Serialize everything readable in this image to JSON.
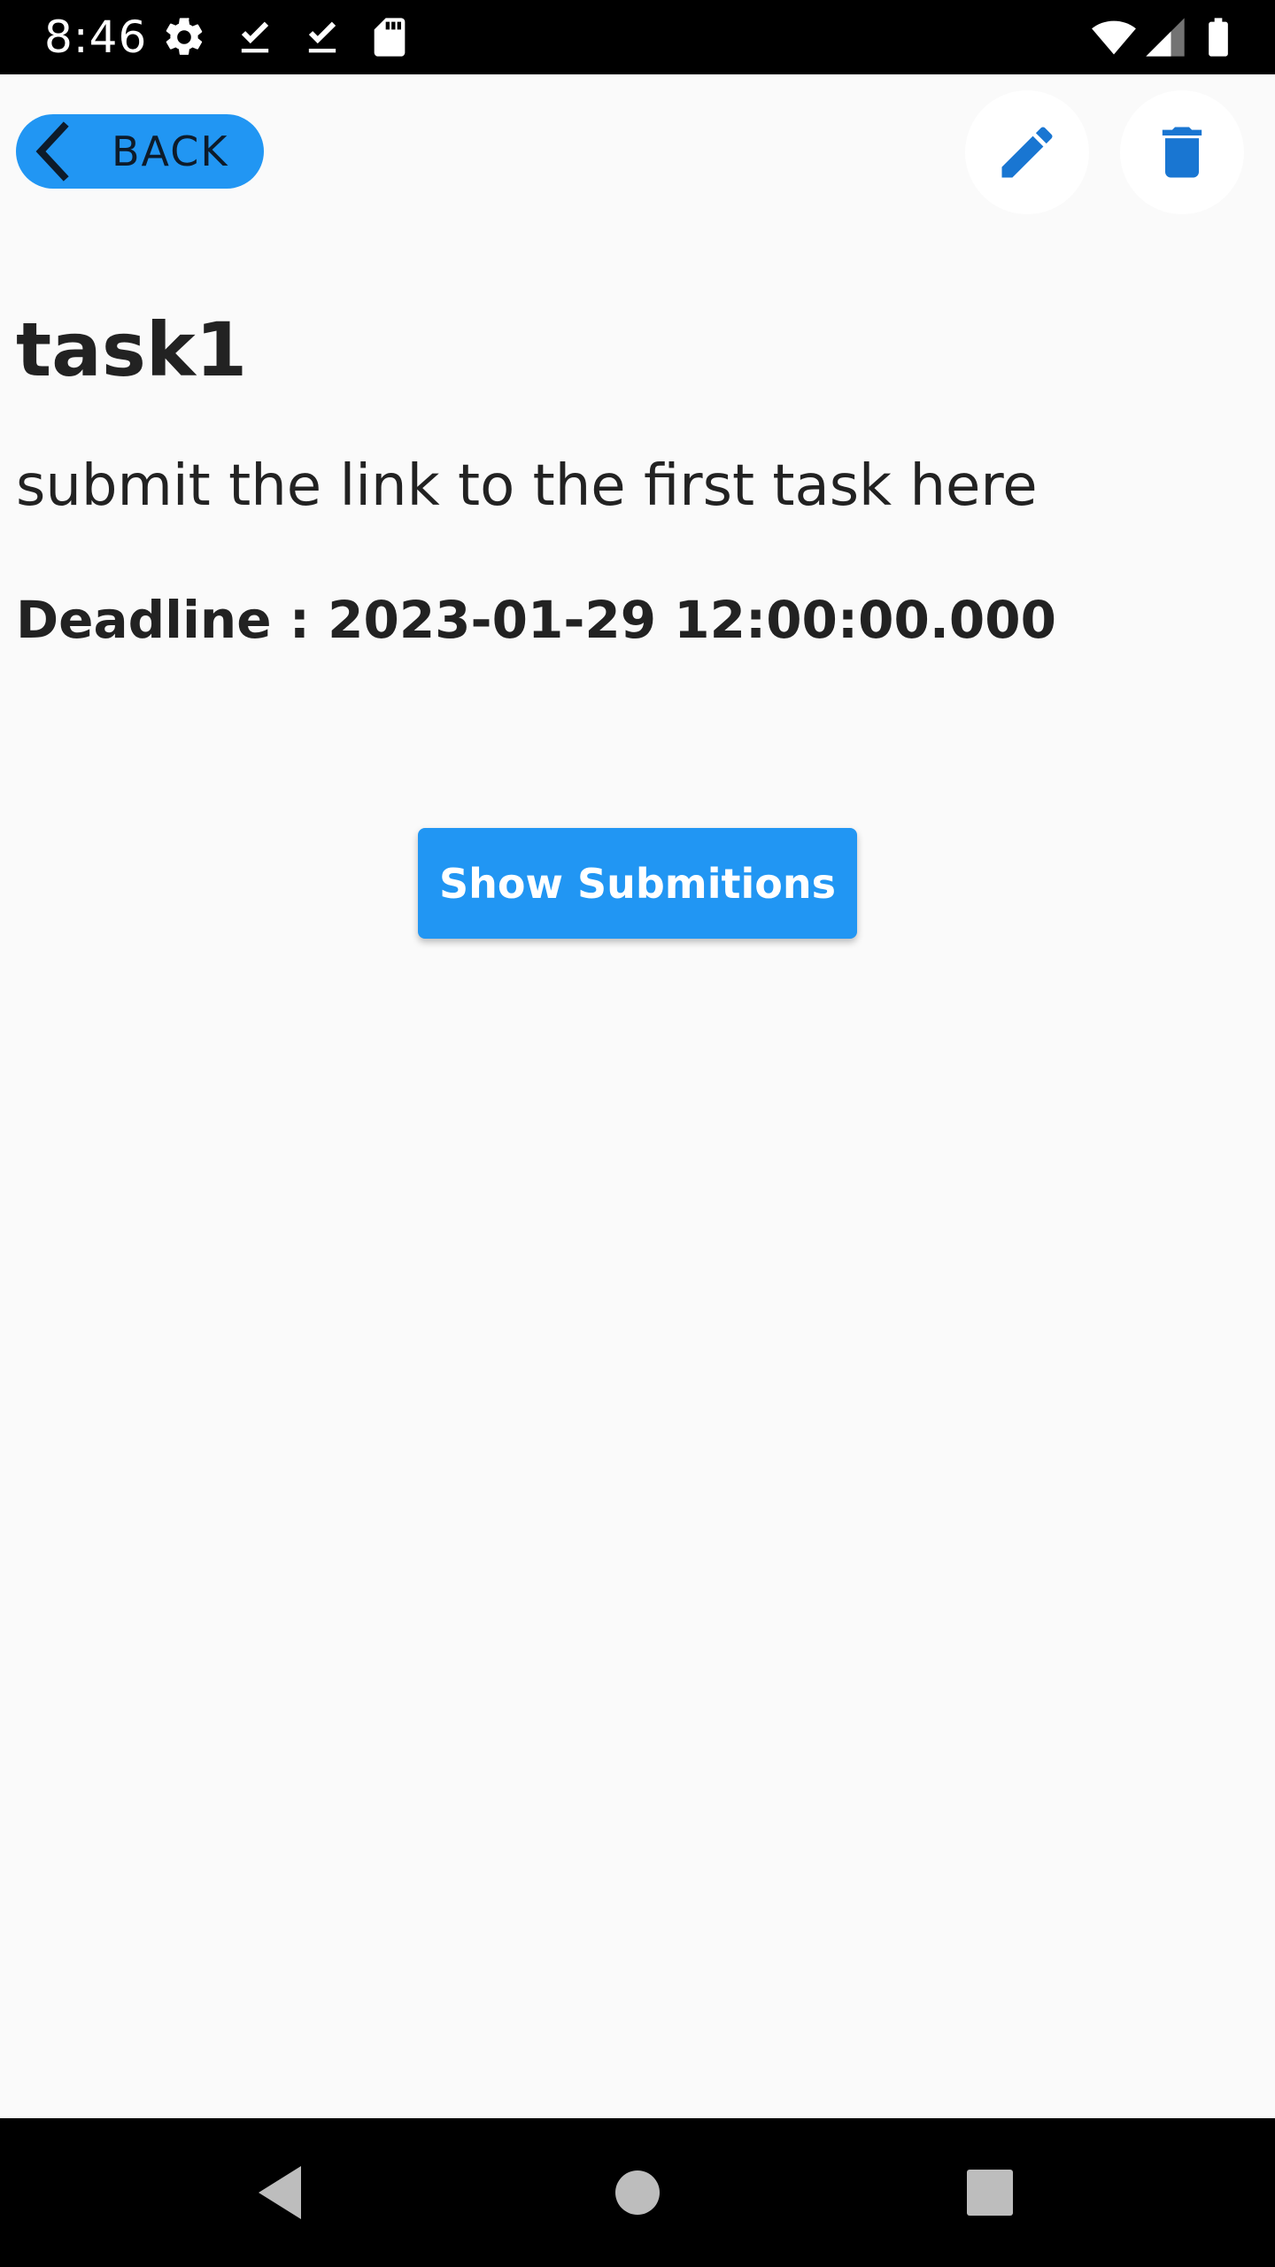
{
  "status_bar": {
    "time": "8:46",
    "left_icons": [
      "gear-icon",
      "download-done-icon",
      "download-done-icon",
      "sd-card-icon"
    ],
    "right_icons": [
      "wifi-icon",
      "cellular-signal-icon",
      "battery-icon"
    ]
  },
  "header": {
    "back_label": "BACK",
    "actions": [
      "edit-icon",
      "delete-icon"
    ]
  },
  "task": {
    "title": "task1",
    "description": "submit the link to the first task here",
    "deadline": "Deadline : 2023-01-29 12:00:00.000"
  },
  "actions": {
    "show_submissions_label": "Show Submitions"
  },
  "nav_bar": {
    "buttons": [
      "back-triangle-icon",
      "home-circle-icon",
      "recents-square-icon"
    ]
  },
  "colors": {
    "accent": "#2196f3",
    "icon_blue": "#1976d2",
    "background": "#fafafa",
    "text": "#222222",
    "system_bars": "#000000"
  }
}
